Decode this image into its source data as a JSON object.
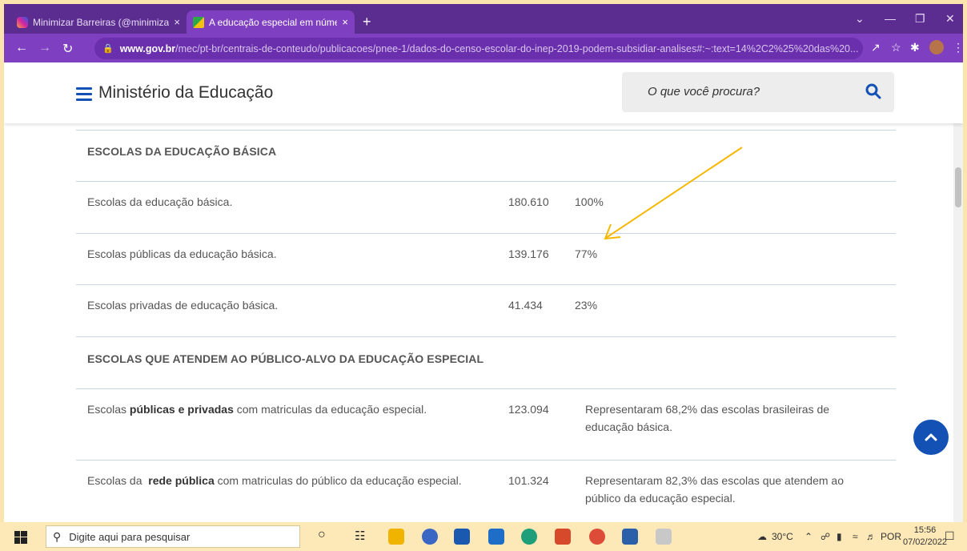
{
  "browser": {
    "tabs": [
      {
        "title": "Minimizar Barreiras (@minimizar",
        "close": "×"
      },
      {
        "title": "A educação especial em número",
        "close": "×"
      }
    ],
    "new_tab": "+",
    "url_domain": "www.gov.br",
    "url_path": "/mec/pt-br/centrais-de-conteudo/publicacoes/pnee-1/dados-do-censo-escolar-do-inep-2019-podem-subsidiar-analises#:~:text=14%2C2%25%20das%20..."
  },
  "site": {
    "title": "Ministério da Educação",
    "search_placeholder": "O que você procura?"
  },
  "table": {
    "section1": "ESCOLAS DA EDUCAÇÃO BÁSICA",
    "rows1": [
      {
        "label": "Escolas da educação básica.",
        "value": "180.610",
        "pct": "100%"
      },
      {
        "label": "Escolas públicas da educação básica.",
        "value": "139.176",
        "pct": "77%"
      },
      {
        "label": "Escolas privadas de educação básica.",
        "value": "41.434",
        "pct": "23%"
      }
    ],
    "section2": "ESCOLAS QUE ATENDEM AO PÚBLICO-ALVO DA EDUCAÇÃO ESPECIAL",
    "rows2": [
      {
        "pre": "Escolas ",
        "bold": "públicas e privadas",
        "post": " com matriculas da educação especial.",
        "value": "123.094",
        "note": "Representaram 68,2% das escolas brasileiras de educação básica."
      },
      {
        "pre": "Escolas da  ",
        "bold": "rede pública",
        "post": " com matriculas do público da educação especial.",
        "value": "101.324",
        "note": "Representaram 82,3% das escolas que atendem ao público da educação especial."
      }
    ]
  },
  "taskbar": {
    "search_placeholder": "Digite aqui para pesquisar",
    "weather": "30°C",
    "lang": "POR",
    "time": "15:56",
    "date": "07/02/2022"
  },
  "colors": {
    "brand": "#1351b4",
    "annotation": "#f5b800",
    "chrome": "#7e3fc0"
  }
}
